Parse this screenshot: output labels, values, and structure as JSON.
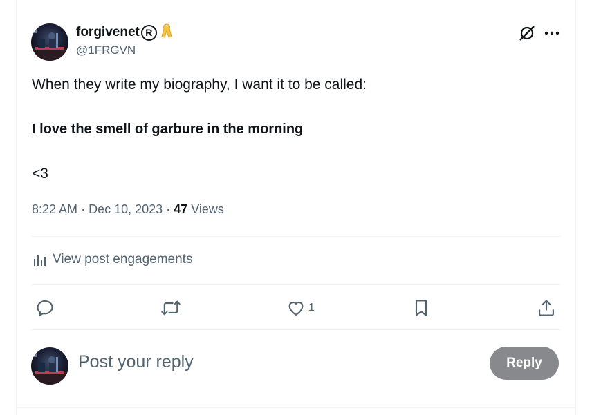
{
  "author": {
    "display_name": "forgivenet",
    "registered_mark": "R",
    "badge_icon": "yellow-ribbon-icon",
    "handle": "@1FRGVN"
  },
  "post": {
    "line1": "When they write my biography, I want it to be called:",
    "line2": "I love the smell of garbure in the morning",
    "line3": "<3",
    "time": "8:22 AM",
    "date": "Dec 10, 2023",
    "views_count": "47",
    "views_label": "Views"
  },
  "engagements": {
    "label": "View post engagements",
    "icon": "analytics-icon"
  },
  "actions": {
    "reply_icon": "reply-icon",
    "repost_icon": "repost-icon",
    "like_icon": "heart-icon",
    "like_count": "1",
    "bookmark_icon": "bookmark-icon",
    "share_icon": "share-icon"
  },
  "reply_box": {
    "placeholder": "Post your reply",
    "button_label": "Reply"
  },
  "colors": {
    "text_primary": "#0f1419",
    "text_secondary": "#536471",
    "divider": "#eff3f4",
    "reply_button_disabled": "#87898c",
    "ribbon": "#f4c542"
  }
}
